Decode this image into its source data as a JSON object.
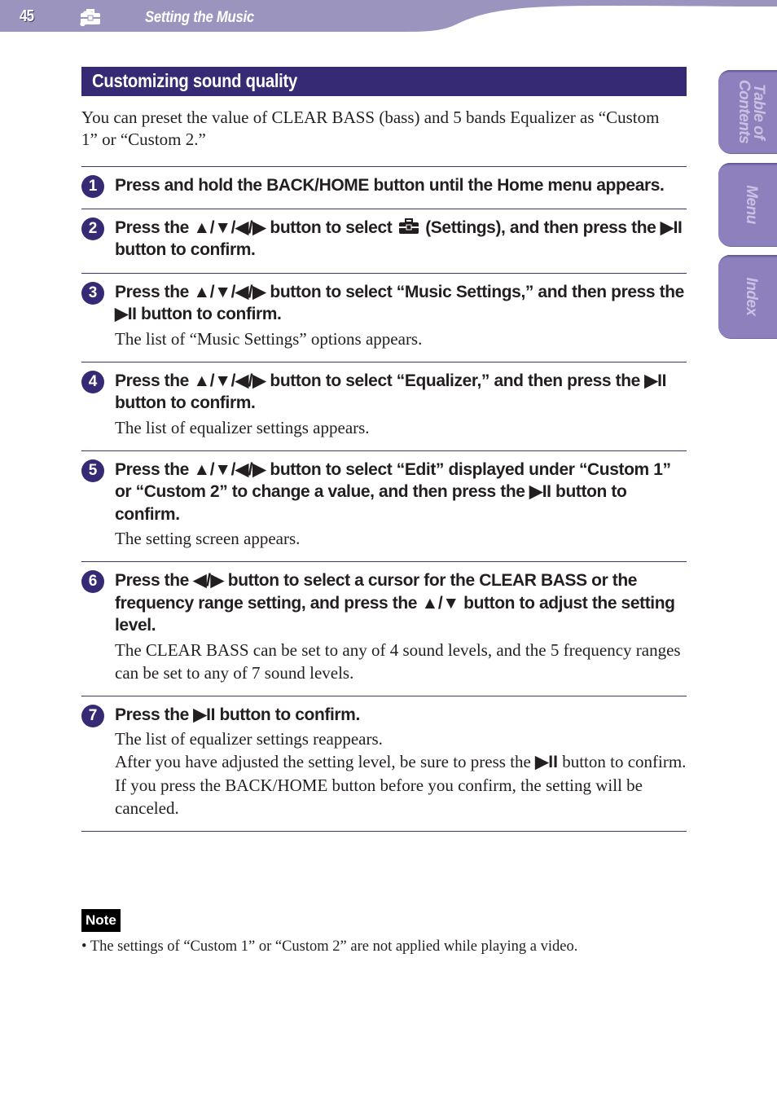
{
  "header": {
    "page_number": "45",
    "icons": [
      "music-note-icon",
      "settings-toolbox-icon"
    ],
    "title": "Setting the Music",
    "bar_color": "#9b94bf"
  },
  "side_tabs": [
    {
      "label": "Table of\nContents"
    },
    {
      "label": "Menu"
    },
    {
      "label": "Index"
    }
  ],
  "section": {
    "title": "Customizing sound quality",
    "intro": "You can preset the value of CLEAR BASS (bass) and 5 bands Equalizer as “Custom 1” or “Custom 2.”"
  },
  "buttons": {
    "nav_symbol": "▲/▼/◀/▶",
    "lr_symbol": "◀/▶",
    "ud_symbol": "▲/▼",
    "play_symbol": "▶II"
  },
  "steps": [
    {
      "number": "1",
      "title": "Press and hold the BACK/HOME button until the Home menu appears.",
      "desc": []
    },
    {
      "number": "2",
      "title_parts": [
        "Press the ",
        "▲/▼/◀/▶",
        " button to select ",
        "(Settings), and then press the ",
        "▶II",
        " button to confirm."
      ],
      "desc": []
    },
    {
      "number": "3",
      "title_parts": [
        "Press the ",
        "▲/▼/◀/▶",
        " button to select “Music Settings,” and then press the ",
        "▶II",
        " button to confirm."
      ],
      "desc": [
        "The list of “Music Settings” options appears."
      ]
    },
    {
      "number": "4",
      "title_parts": [
        "Press the ",
        "▲/▼/◀/▶",
        " button to select “Equalizer,” and then press the ",
        "▶II",
        " button to confirm."
      ],
      "desc": [
        "The list of equalizer settings appears."
      ]
    },
    {
      "number": "5",
      "title_parts": [
        "Press the ",
        "▲/▼/◀/▶",
        " button to select “Edit” displayed under “Custom 1” or “Custom 2” to change a value, and then press the ",
        "▶II",
        " button to confirm."
      ],
      "desc": [
        "The setting screen appears."
      ]
    },
    {
      "number": "6",
      "title_parts": [
        "Press the ",
        "◀/▶",
        " button to select a cursor for the CLEAR BASS or the frequency range setting, and press the ",
        "▲/▼",
        " button to adjust the setting level."
      ],
      "desc": [
        "The CLEAR BASS can be set to any of 4 sound levels, and the 5 frequency ranges can be set to any of 7 sound levels."
      ]
    },
    {
      "number": "7",
      "title_parts": [
        "Press the ",
        "▶II",
        " button to confirm."
      ],
      "desc": [
        "The list of equalizer settings reappears."
      ],
      "desc2_parts": [
        "After you have adjusted the setting level, be sure to press the ",
        "▶II",
        " button to confirm. If you press the BACK/HOME button before you confirm, the setting will be canceled."
      ]
    }
  ],
  "note": {
    "label": "Note",
    "text": "• The settings of “Custom 1” or “Custom 2” are not applied while playing a video."
  }
}
